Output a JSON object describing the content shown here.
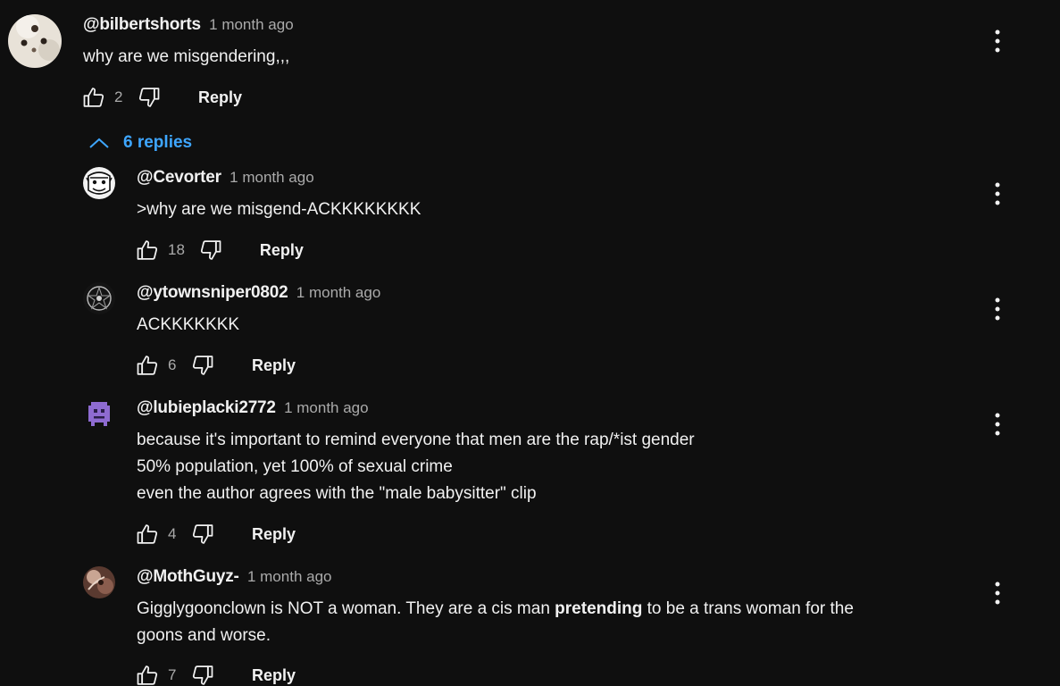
{
  "colors": {
    "background": "#0f0f0f",
    "text": "#f1f1f1",
    "secondary": "#aaaaaa",
    "link": "#3ea6ff"
  },
  "icons": {
    "like": "thumb-up-icon",
    "dislike": "thumb-down-icon",
    "menu": "more-vert-icon",
    "collapse": "chevron-up-icon"
  },
  "top_comment": {
    "author": "@bilbertshorts",
    "time": "1 month ago",
    "text": "why are we misgendering,,,",
    "likes": "2",
    "reply_label": "Reply"
  },
  "replies_toggle": {
    "label": "6 replies"
  },
  "replies": [
    {
      "author": "@Cevorter",
      "time": "1 month ago",
      "text": ">why are we misgend-ACKKKKKKKK",
      "likes": "18",
      "reply_label": "Reply"
    },
    {
      "author": "@ytownsniper0802",
      "time": "1 month ago",
      "text": "ACKKKKKKK",
      "likes": "6",
      "reply_label": "Reply"
    },
    {
      "author": "@lubieplacki2772",
      "time": "1 month ago",
      "text": "because it's important to remind everyone that men are the rap/*ist gender\n50% population, yet 100% of sexual crime\neven the author agrees with the \"male babysitter\" clip",
      "likes": "4",
      "reply_label": "Reply"
    },
    {
      "author": "@MothGuyz-",
      "time": "1 month ago",
      "text_before": "Gigglygoonclown is NOT a woman. They are a cis man ",
      "text_bold": "pretending",
      "text_after": " to be a trans woman for the\ngoons and worse.",
      "likes": "7",
      "reply_label": "Reply"
    }
  ]
}
